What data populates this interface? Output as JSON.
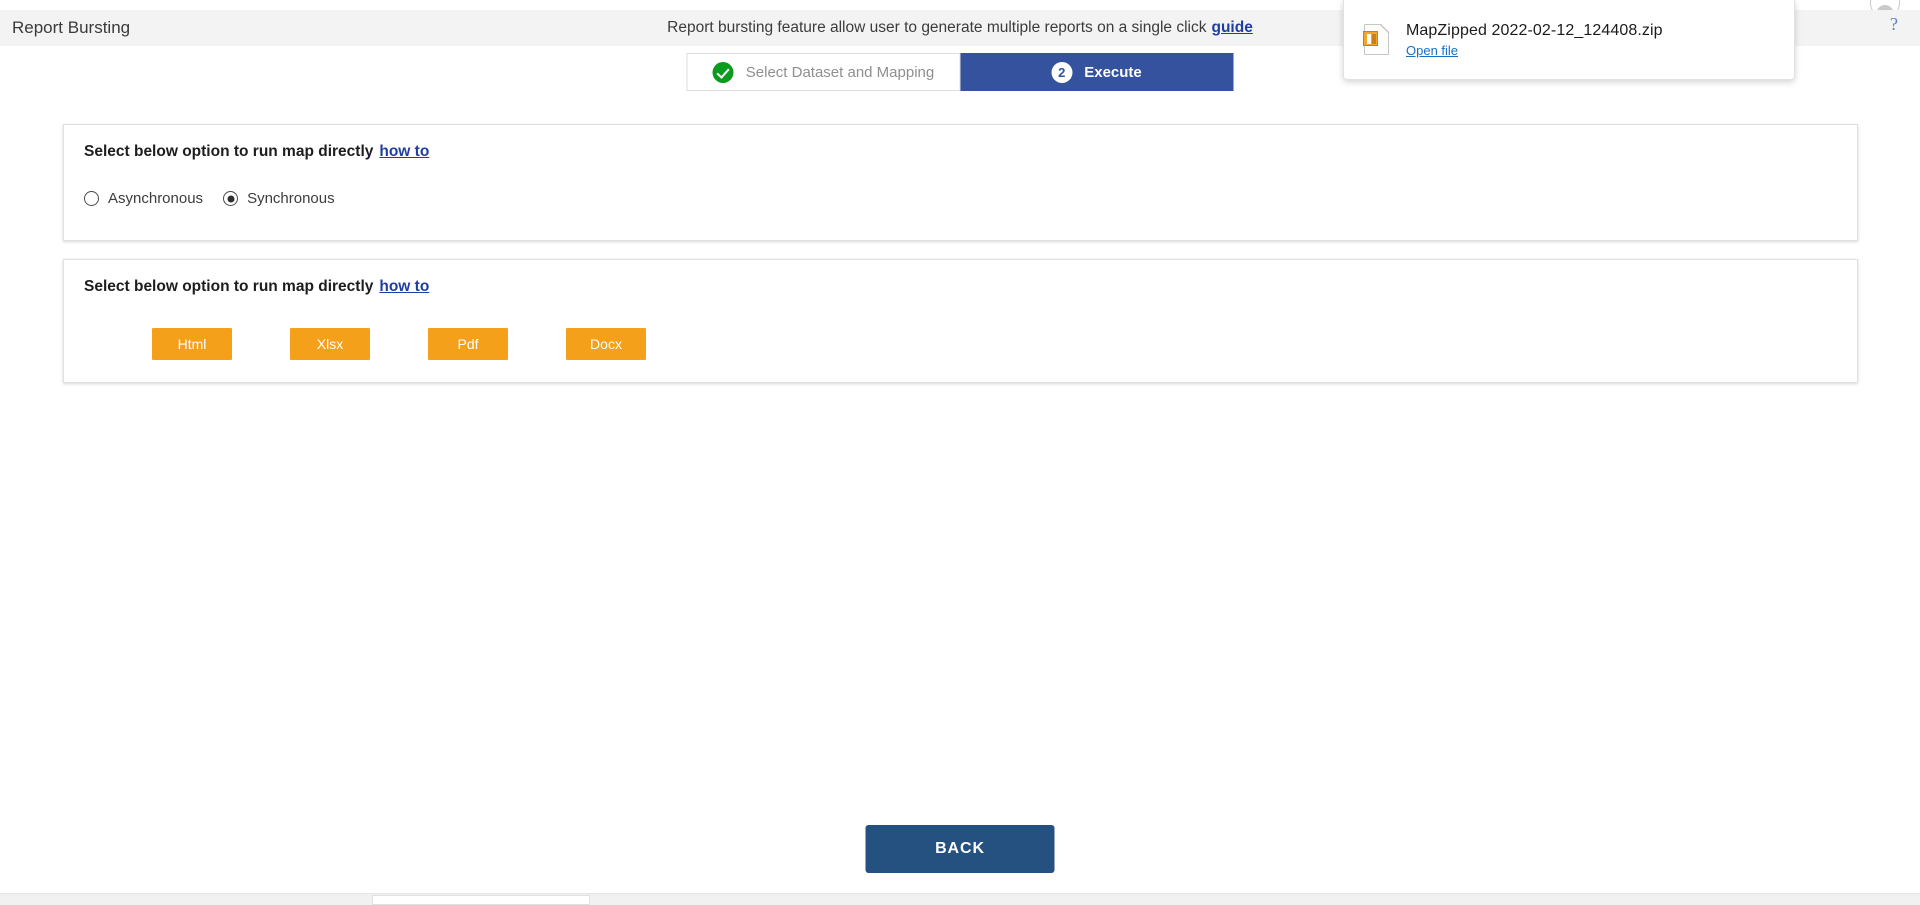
{
  "browser": {
    "help_icon": "question-mark-icon",
    "profile_icon": "user-avatar-icon"
  },
  "download_bubble": {
    "file_icon": "zip-file-icon",
    "file_name": "MapZipped 2022-02-12_124408.zip",
    "open_file_label": "Open file"
  },
  "header": {
    "app_title": "Report Bursting",
    "tagline": "Report bursting feature allow user to generate multiple reports on a single click",
    "guide_label": "guide"
  },
  "stepper": {
    "steps": [
      {
        "label": "Select Dataset and Mapping",
        "indicator": "check-icon",
        "state": "completed"
      },
      {
        "label": "Execute",
        "indicator": "2",
        "state": "active"
      }
    ]
  },
  "cards": [
    {
      "heading": "Select below option to run map directly",
      "howto_label": "how to",
      "radios": [
        {
          "label": "Asynchronous",
          "selected": false
        },
        {
          "label": "Synchronous",
          "selected": true
        }
      ]
    },
    {
      "heading": "Select below option to run map directly",
      "howto_label": "how to",
      "buttons": [
        {
          "label": "Html"
        },
        {
          "label": "Xlsx"
        },
        {
          "label": "Pdf"
        },
        {
          "label": "Docx"
        }
      ]
    }
  ],
  "footer": {
    "back_label": "BACK"
  },
  "colors": {
    "stepper_active": "#35529f",
    "check_green": "#0a9b1f",
    "format_orange": "#f5a01b",
    "back_blue": "#255180",
    "link_blue": "#1f3fa0",
    "header_bg": "#f3f3f3"
  }
}
